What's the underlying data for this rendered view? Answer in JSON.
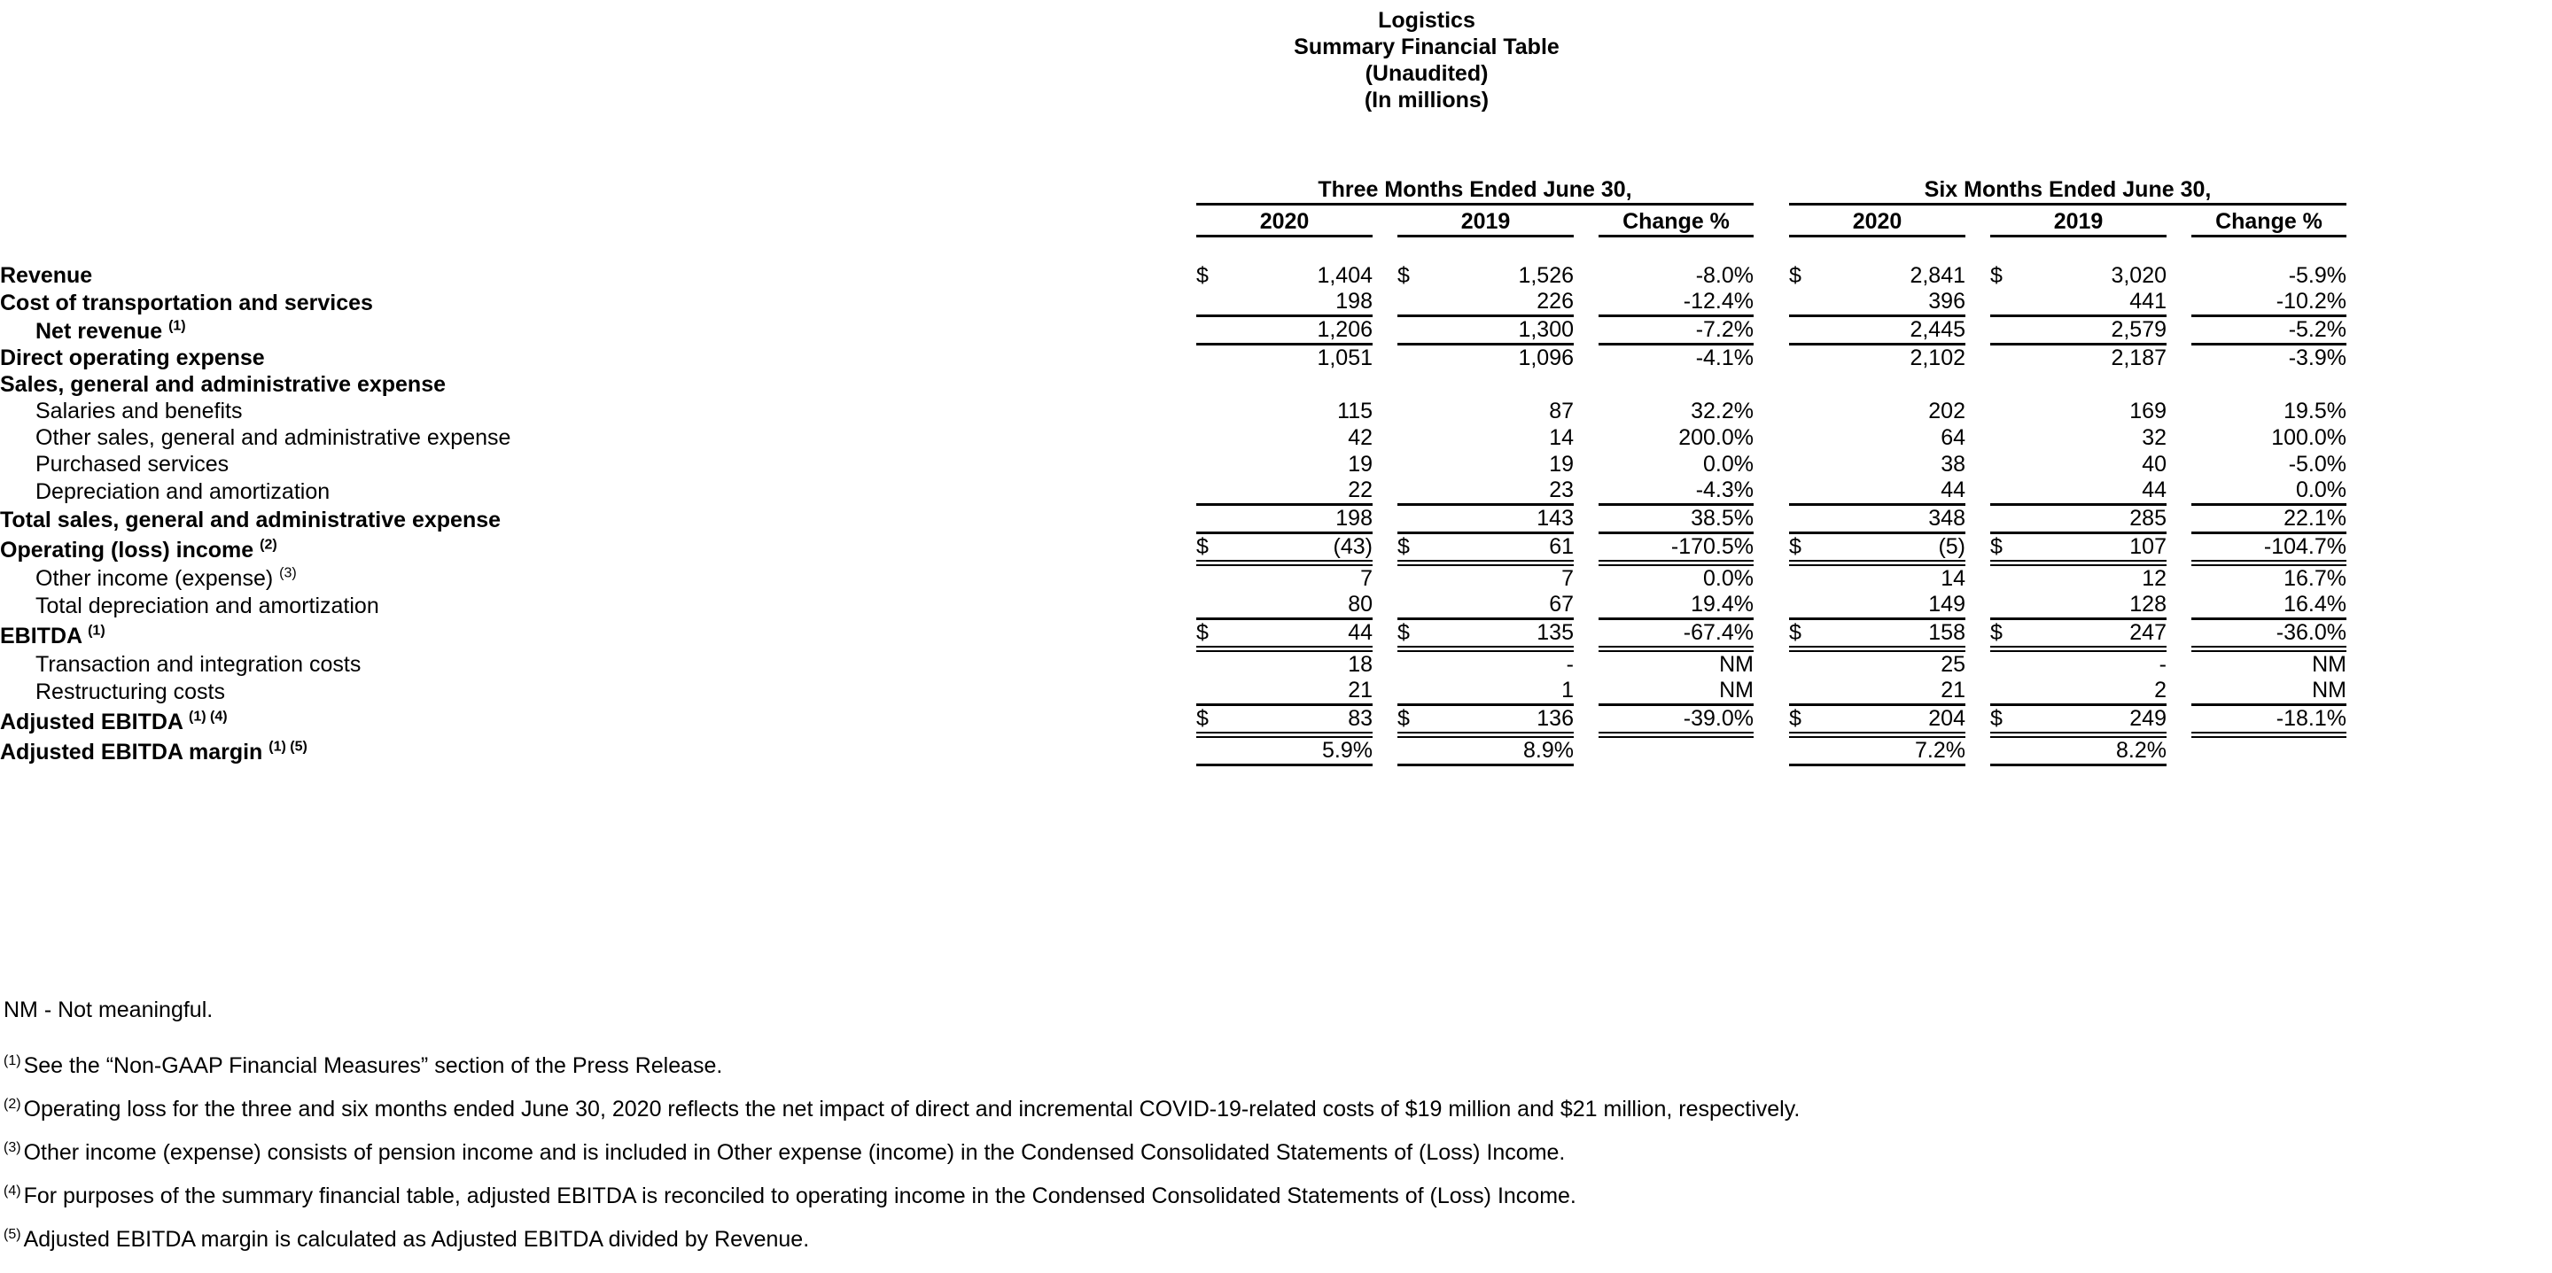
{
  "title": {
    "line1": "Logistics",
    "line2": "Summary Financial Table",
    "line3": "(Unaudited)",
    "line4": "(In millions)"
  },
  "header": {
    "group_three_months": "Three Months Ended June 30,",
    "group_six_months": "Six Months Ended June 30,",
    "col_2020": "2020",
    "col_2019": "2019",
    "col_change": "Change %"
  },
  "symbols": {
    "dollar": "$",
    "dash": "-",
    "nm": "NM"
  },
  "rows": [
    {
      "label": "Revenue",
      "q_cur_2020": "$",
      "q_2020": "1,404",
      "q_cur_2019": "$",
      "q_2019": "1,526",
      "q_change": "-8.0%",
      "y_cur_2020": "$",
      "y_2020": "2,841",
      "y_cur_2019": "$",
      "y_2019": "3,020",
      "y_change": "-5.9%"
    },
    {
      "label": "Cost of transportation and services",
      "q_cur_2020": "",
      "q_2020": "198",
      "q_cur_2019": "",
      "q_2019": "226",
      "q_change": "-12.4%",
      "y_cur_2020": "",
      "y_2020": "396",
      "y_cur_2019": "",
      "y_2019": "441",
      "y_change": "-10.2%"
    },
    {
      "label": "Net revenue",
      "note": "(1)",
      "q_cur_2020": "",
      "q_2020": "1,206",
      "q_cur_2019": "",
      "q_2019": "1,300",
      "q_change": "-7.2%",
      "y_cur_2020": "",
      "y_2020": "2,445",
      "y_cur_2019": "",
      "y_2019": "2,579",
      "y_change": "-5.2%"
    },
    {
      "label": "Direct operating expense",
      "q_cur_2020": "",
      "q_2020": "1,051",
      "q_cur_2019": "",
      "q_2019": "1,096",
      "q_change": "-4.1%",
      "y_cur_2020": "",
      "y_2020": "2,102",
      "y_cur_2019": "",
      "y_2019": "2,187",
      "y_change": "-3.9%"
    },
    {
      "label": "Sales, general and administrative expense",
      "q_cur_2020": "",
      "q_2020": "",
      "q_cur_2019": "",
      "q_2019": "",
      "q_change": "",
      "y_cur_2020": "",
      "y_2020": "",
      "y_cur_2019": "",
      "y_2019": "",
      "y_change": ""
    },
    {
      "label": "Salaries and benefits",
      "q_cur_2020": "",
      "q_2020": "115",
      "q_cur_2019": "",
      "q_2019": "87",
      "q_change": "32.2%",
      "y_cur_2020": "",
      "y_2020": "202",
      "y_cur_2019": "",
      "y_2019": "169",
      "y_change": "19.5%"
    },
    {
      "label": "Other sales, general and administrative expense",
      "q_cur_2020": "",
      "q_2020": "42",
      "q_cur_2019": "",
      "q_2019": "14",
      "q_change": "200.0%",
      "y_cur_2020": "",
      "y_2020": "64",
      "y_cur_2019": "",
      "y_2019": "32",
      "y_change": "100.0%"
    },
    {
      "label": "Purchased services",
      "q_cur_2020": "",
      "q_2020": "19",
      "q_cur_2019": "",
      "q_2019": "19",
      "q_change": "0.0%",
      "y_cur_2020": "",
      "y_2020": "38",
      "y_cur_2019": "",
      "y_2019": "40",
      "y_change": "-5.0%"
    },
    {
      "label": "Depreciation and amortization",
      "q_cur_2020": "",
      "q_2020": "22",
      "q_cur_2019": "",
      "q_2019": "23",
      "q_change": "-4.3%",
      "y_cur_2020": "",
      "y_2020": "44",
      "y_cur_2019": "",
      "y_2019": "44",
      "y_change": "0.0%"
    },
    {
      "label": "Total sales, general and administrative expense",
      "q_cur_2020": "",
      "q_2020": "198",
      "q_cur_2019": "",
      "q_2019": "143",
      "q_change": "38.5%",
      "y_cur_2020": "",
      "y_2020": "348",
      "y_cur_2019": "",
      "y_2019": "285",
      "y_change": "22.1%"
    },
    {
      "label": "Operating (loss) income",
      "note": "(2)",
      "q_cur_2020": "$",
      "q_2020": "(43)",
      "q_cur_2019": "$",
      "q_2019": "61",
      "q_change": "-170.5%",
      "y_cur_2020": "$",
      "y_2020": "(5)",
      "y_cur_2019": "$",
      "y_2019": "107",
      "y_change": "-104.7%"
    },
    {
      "label": "Other income (expense)",
      "note": "(3)",
      "q_cur_2020": "",
      "q_2020": "7",
      "q_cur_2019": "",
      "q_2019": "7",
      "q_change": "0.0%",
      "y_cur_2020": "",
      "y_2020": "14",
      "y_cur_2019": "",
      "y_2019": "12",
      "y_change": "16.7%"
    },
    {
      "label": "Total depreciation and amortization",
      "q_cur_2020": "",
      "q_2020": "80",
      "q_cur_2019": "",
      "q_2019": "67",
      "q_change": "19.4%",
      "y_cur_2020": "",
      "y_2020": "149",
      "y_cur_2019": "",
      "y_2019": "128",
      "y_change": "16.4%"
    },
    {
      "label": "EBITDA",
      "note": "(1)",
      "q_cur_2020": "$",
      "q_2020": "44",
      "q_cur_2019": "$",
      "q_2019": "135",
      "q_change": "-67.4%",
      "y_cur_2020": "$",
      "y_2020": "158",
      "y_cur_2019": "$",
      "y_2019": "247",
      "y_change": "-36.0%"
    },
    {
      "label": "Transaction and integration costs",
      "q_cur_2020": "",
      "q_2020": "18",
      "q_cur_2019": "",
      "q_2019": "-",
      "q_change": "NM",
      "y_cur_2020": "",
      "y_2020": "25",
      "y_cur_2019": "",
      "y_2019": "-",
      "y_change": "NM"
    },
    {
      "label": "Restructuring costs",
      "q_cur_2020": "",
      "q_2020": "21",
      "q_cur_2019": "",
      "q_2019": "1",
      "q_change": "NM",
      "y_cur_2020": "",
      "y_2020": "21",
      "y_cur_2019": "",
      "y_2019": "2",
      "y_change": "NM"
    },
    {
      "label": "Adjusted EBITDA",
      "note": "(1) (4)",
      "q_cur_2020": "$",
      "q_2020": "83",
      "q_cur_2019": "$",
      "q_2019": "136",
      "q_change": "-39.0%",
      "y_cur_2020": "$",
      "y_2020": "204",
      "y_cur_2019": "$",
      "y_2019": "249",
      "y_change": "-18.1%"
    },
    {
      "label": "Adjusted EBITDA margin",
      "note": "(1) (5)",
      "q_cur_2020": "",
      "q_2020": "5.9%",
      "q_cur_2019": "",
      "q_2019": "8.9%",
      "q_change": "",
      "y_cur_2020": "",
      "y_2020": "7.2%",
      "y_cur_2019": "",
      "y_2019": "8.2%",
      "y_change": ""
    }
  ],
  "footnotes": {
    "nm": "NM - Not meaningful.",
    "n1_mark": "(1)",
    "n1": "See the “Non-GAAP Financial Measures” section of the Press Release.",
    "n2_mark": "(2)",
    "n2": "Operating loss for the three and six months ended June 30, 2020 reflects the net impact of direct and incremental COVID-19-related costs of $19 million and $21 million, respectively.",
    "n3_mark": "(3)",
    "n3": "Other income (expense) consists of pension income and is included in Other expense (income) in the Condensed Consolidated Statements of (Loss) Income.",
    "n4_mark": "(4)",
    "n4": "For purposes of the summary financial table, adjusted EBITDA is reconciled to operating income in the Condensed Consolidated Statements of (Loss) Income.",
    "n5_mark": "(5)",
    "n5": "Adjusted EBITDA margin is calculated as Adjusted EBITDA divided by Revenue."
  }
}
